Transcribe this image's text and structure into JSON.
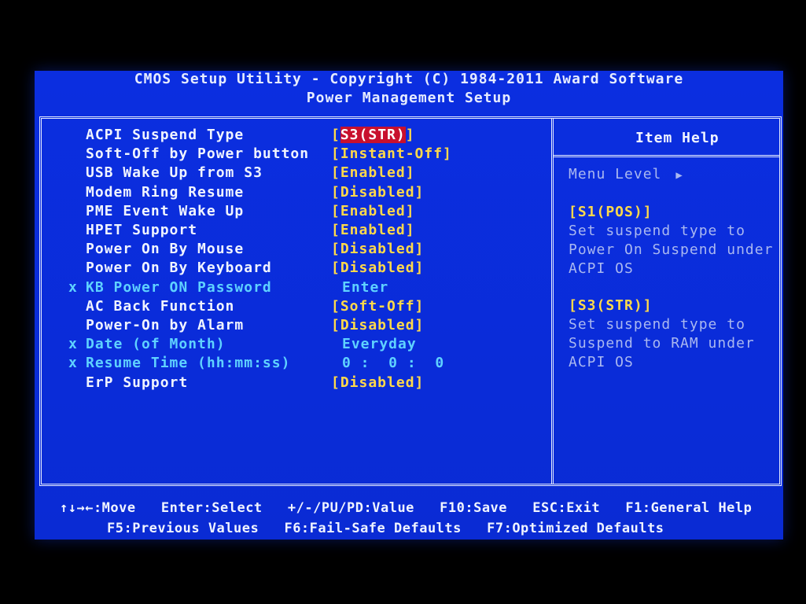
{
  "header": {
    "title": "CMOS Setup Utility - Copyright (C) 1984-2011 Award Software",
    "subtitle": "Power Management Setup"
  },
  "settings": [
    {
      "mark": "",
      "label": "ACPI Suspend Type",
      "value": "[S3(STR)]",
      "value_inner": "S3(STR)",
      "state": "selected"
    },
    {
      "mark": "",
      "label": "Soft-Off by Power button",
      "value": "[Instant-Off]",
      "state": "normal"
    },
    {
      "mark": "",
      "label": "USB Wake Up from S3",
      "value": "[Enabled]",
      "state": "normal"
    },
    {
      "mark": "",
      "label": "Modem Ring Resume",
      "value": "[Disabled]",
      "state": "normal"
    },
    {
      "mark": "",
      "label": "PME Event Wake Up",
      "value": "[Enabled]",
      "state": "normal"
    },
    {
      "mark": "",
      "label": "HPET Support",
      "value": "[Enabled]",
      "state": "normal"
    },
    {
      "mark": "",
      "label": "Power On By Mouse",
      "value": "[Disabled]",
      "state": "normal"
    },
    {
      "mark": "",
      "label": "Power On By Keyboard",
      "value": "[Disabled]",
      "state": "normal"
    },
    {
      "mark": "x",
      "label": "KB Power ON Password",
      "value": "Enter",
      "state": "disabled"
    },
    {
      "mark": "",
      "label": "AC Back Function",
      "value": "[Soft-Off]",
      "state": "normal"
    },
    {
      "mark": "",
      "label": "Power-On by Alarm",
      "value": "[Disabled]",
      "state": "normal"
    },
    {
      "mark": "x",
      "label": "Date (of Month)",
      "value": "Everyday",
      "state": "disabled"
    },
    {
      "mark": "x",
      "label": "Resume Time (hh:mm:ss)",
      "value": "0 :  0 :  0",
      "state": "disabled"
    },
    {
      "mark": "",
      "label": "ErP Support",
      "value": "[Disabled]",
      "state": "normal"
    }
  ],
  "help": {
    "title": "Item Help",
    "menu_level": "Menu Level",
    "menu_level_icon": "triangle-right-icon",
    "blocks": [
      {
        "key": "[S1(POS)]",
        "lines": [
          "Set suspend type to",
          "Power On Suspend under",
          "ACPI OS"
        ]
      },
      {
        "key": "[S3(STR)]",
        "lines": [
          "Set suspend type to",
          "Suspend to RAM under",
          "ACPI OS"
        ]
      }
    ]
  },
  "footer": {
    "row1": [
      "↑↓→←:Move",
      "Enter:Select",
      "+/-/PU/PD:Value",
      "F10:Save",
      "ESC:Exit",
      "F1:General Help"
    ],
    "row2": [
      "F5:Previous Values",
      "F6:Fail-Safe Defaults",
      "F7:Optimized Defaults"
    ]
  },
  "colors": {
    "background": "#0a2fd6",
    "value_text": "#ffd94a",
    "disabled_text": "#5fd2ff",
    "highlight": "#c8102e"
  }
}
